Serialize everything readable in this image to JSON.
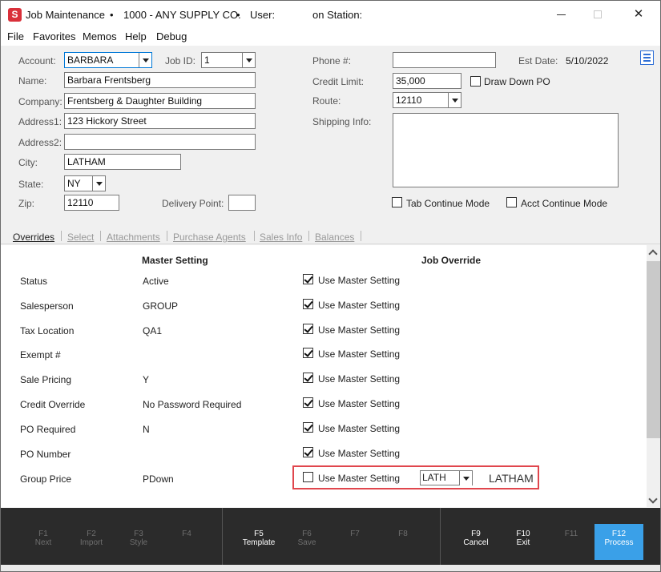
{
  "window": {
    "app_icon_letter": "S",
    "title": "Job Maintenance",
    "company": "1000 - ANY SUPPLY CO.",
    "user_label": "User:",
    "station_label": "on Station:",
    "close_glyph": "✕"
  },
  "menu": [
    "File",
    "Favorites",
    "Memos",
    "Help",
    "Debug"
  ],
  "form": {
    "account_label": "Account:",
    "account_value": "BARBARA",
    "jobid_label": "Job ID:",
    "jobid_value": "1",
    "name_label": "Name:",
    "name_value": "Barbara Frentsberg",
    "company_label": "Company:",
    "company_value": "Frentsberg & Daughter Building",
    "address1_label": "Address1:",
    "address1_value": "123 Hickory Street",
    "address2_label": "Address2:",
    "address2_value": "",
    "city_label": "City:",
    "city_value": "LATHAM",
    "state_label": "State:",
    "state_value": "NY",
    "zip_label": "Zip:",
    "zip_value": "12110",
    "delivery_label": "Delivery Point:",
    "delivery_value": "",
    "phone_label": "Phone #:",
    "phone_value": "",
    "estdate_label": "Est Date:",
    "estdate_value": "5/10/2022",
    "credit_label": "Credit Limit:",
    "credit_value": "35,000",
    "drawdown_label": "Draw Down PO",
    "route_label": "Route:",
    "route_value": "12110",
    "shipping_label": "Shipping Info:",
    "shipping_value": "",
    "tab_continue_label": "Tab Continue Mode",
    "acct_continue_label": "Acct Continue Mode"
  },
  "tabs": [
    "Overrides",
    "Select",
    "Attachments",
    "Purchase Agents",
    "Sales Info",
    "Balances"
  ],
  "grid": {
    "master_header": "Master Setting",
    "override_header": "Job Override",
    "use_master_label": "Use Master Setting",
    "rows": [
      {
        "label": "Status",
        "value": "Active",
        "checked": true
      },
      {
        "label": "Salesperson",
        "value": "GROUP",
        "checked": true
      },
      {
        "label": "Tax Location",
        "value": "QA1",
        "checked": true
      },
      {
        "label": "Exempt #",
        "value": "",
        "checked": true
      },
      {
        "label": "Sale Pricing",
        "value": "Y",
        "checked": true
      },
      {
        "label": "Credit Override",
        "value": "No Password Required",
        "checked": true
      },
      {
        "label": "PO Required",
        "value": "N",
        "checked": true
      },
      {
        "label": "PO Number",
        "value": "",
        "checked": true
      },
      {
        "label": "Group Price",
        "value": "PDown",
        "checked": false
      }
    ],
    "group_price_override_code": "LATH",
    "group_price_override_name": "LATHAM"
  },
  "fkeys": [
    {
      "key": "F1",
      "name": "Next",
      "enabled": false
    },
    {
      "key": "F2",
      "name": "Import",
      "enabled": false
    },
    {
      "key": "F3",
      "name": "Style",
      "enabled": false
    },
    {
      "key": "F4",
      "name": "",
      "enabled": false
    },
    {
      "key": "F5",
      "name": "Template",
      "enabled": true
    },
    {
      "key": "F6",
      "name": "Save",
      "enabled": false
    },
    {
      "key": "F7",
      "name": "",
      "enabled": false
    },
    {
      "key": "F8",
      "name": "",
      "enabled": false
    },
    {
      "key": "F9",
      "name": "Cancel",
      "enabled": true
    },
    {
      "key": "F10",
      "name": "Exit",
      "enabled": true
    },
    {
      "key": "F11",
      "name": "",
      "enabled": false
    },
    {
      "key": "F12",
      "name": "Process",
      "enabled": true
    }
  ],
  "colors": {
    "accent": "#3aa0e8",
    "highlight_border": "#e0464d",
    "icon_red": "#d9303a"
  }
}
